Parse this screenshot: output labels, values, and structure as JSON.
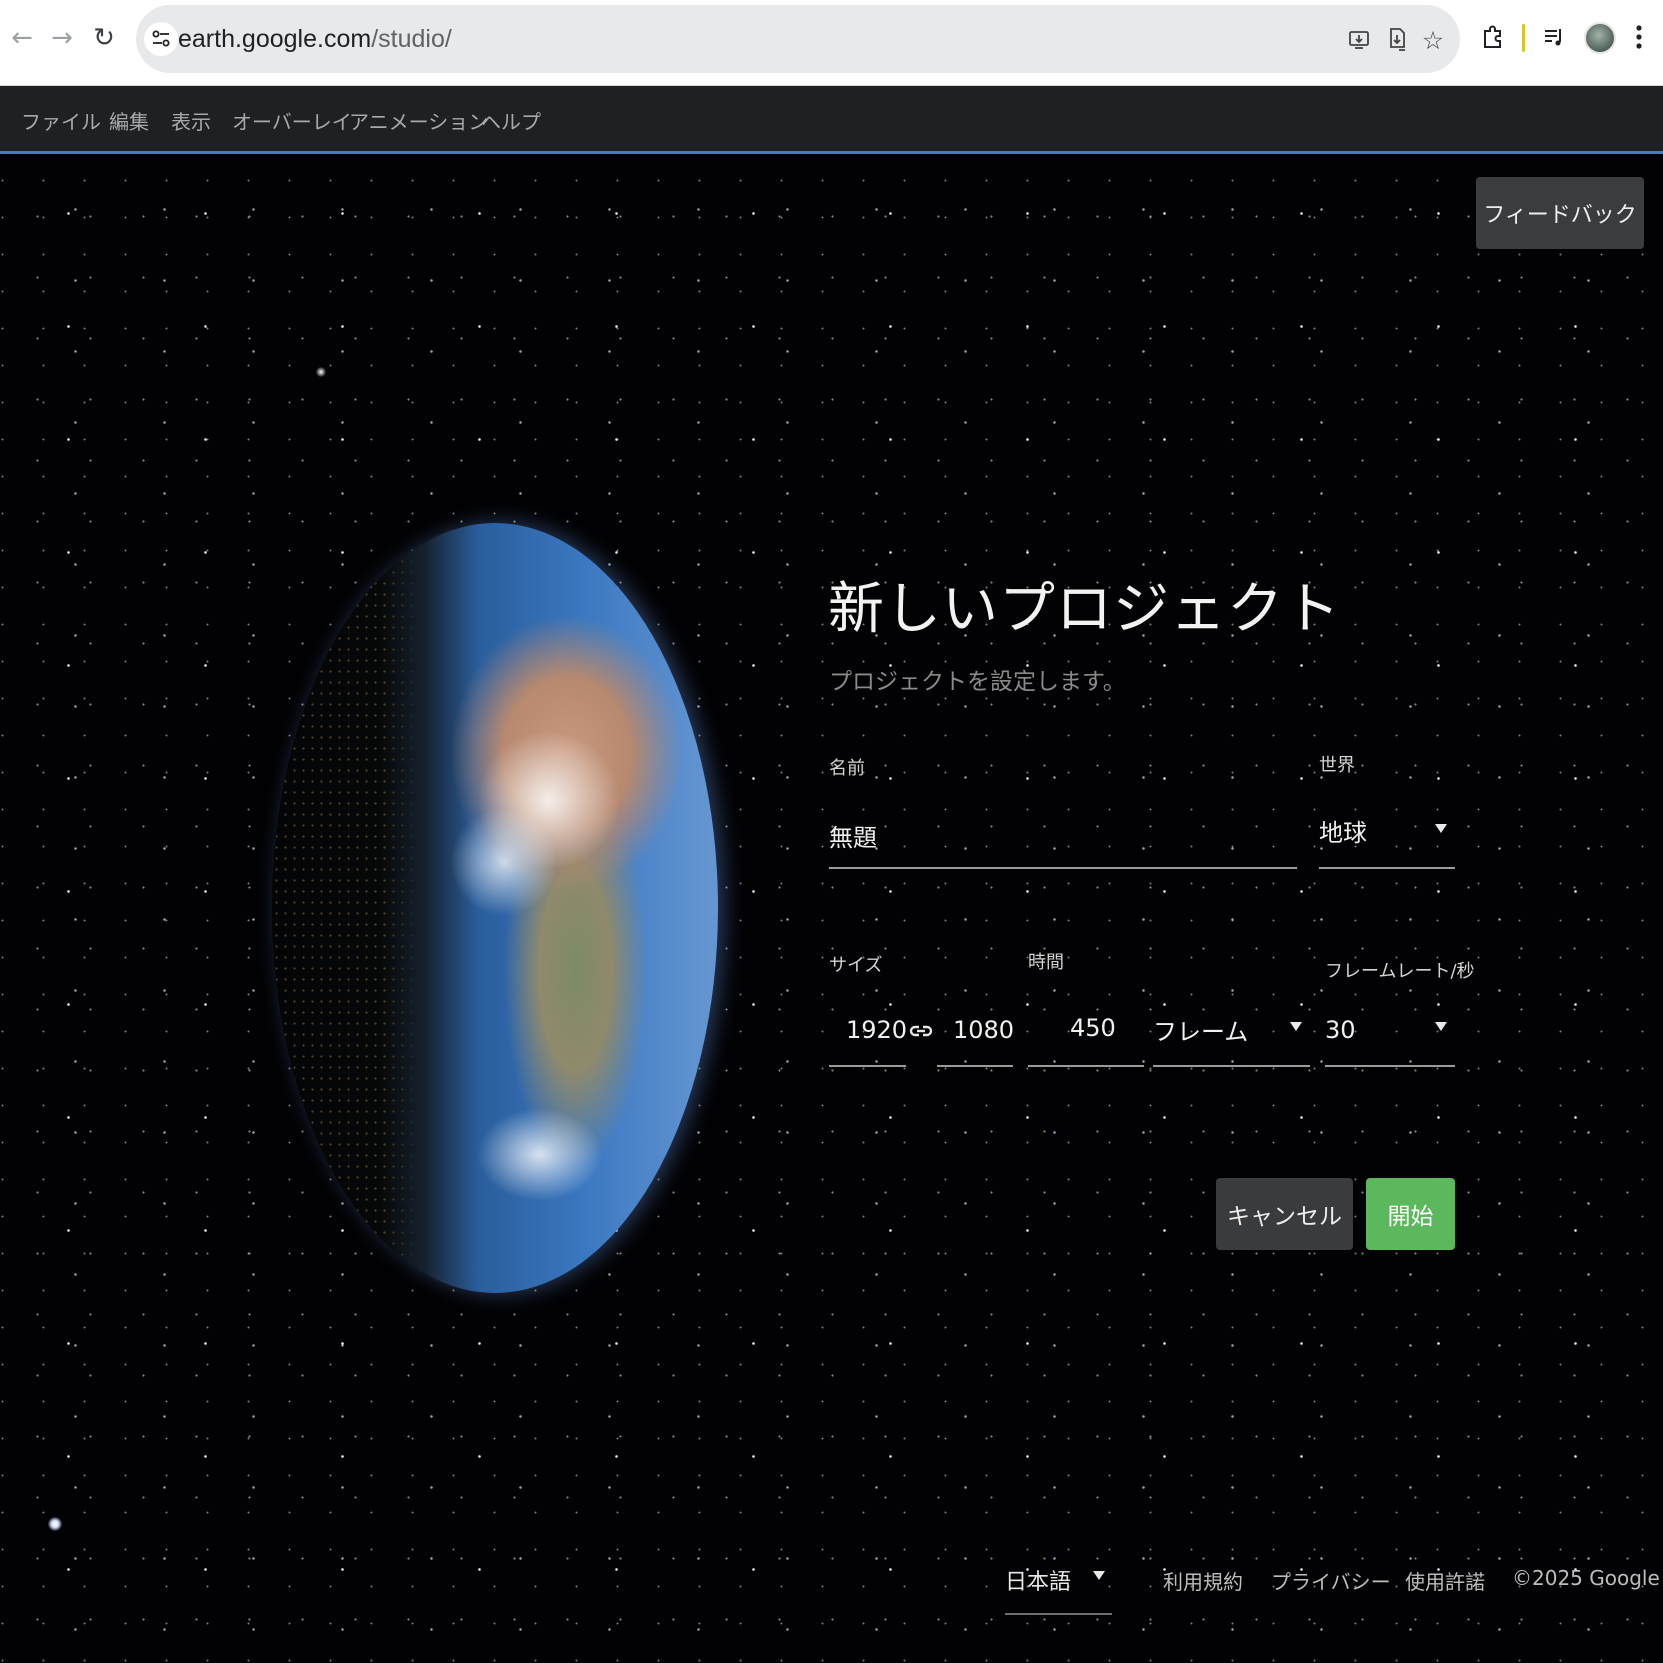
{
  "browser": {
    "url_host": "earth.google.com",
    "url_path": "/studio/",
    "icons": {
      "back": "arrow-left-icon",
      "forward": "arrow-right-icon",
      "reload": "reload-icon",
      "site_info": "tune-icon",
      "install": "install-app-icon",
      "download": "download-icon",
      "bookmark": "star-icon",
      "extensions": "puzzle-icon",
      "reading_list": "playlist-icon",
      "menu": "kebab-menu-icon"
    }
  },
  "menubar": {
    "items": [
      "ファイル",
      "編集",
      "表示",
      "オーバーレイ",
      "アニメーション",
      "ヘルプ"
    ]
  },
  "feedback": {
    "label": "フィードバック"
  },
  "dialog": {
    "title": "新しいプロジェクト",
    "subtitle": "プロジェクトを設定します。",
    "name": {
      "label": "名前",
      "value": "無題"
    },
    "world": {
      "label": "世界",
      "value": "地球"
    },
    "size": {
      "label": "サイズ",
      "width": "1920",
      "height": "1080"
    },
    "duration": {
      "label": "時間",
      "value": "450",
      "unit": "フレーム"
    },
    "framerate": {
      "label": "フレームレート/秒",
      "value": "30"
    },
    "cancel_label": "キャンセル",
    "start_label": "開始"
  },
  "footer": {
    "language": "日本語",
    "terms": "利用規約",
    "privacy": "プライバシー",
    "license": "使用許諾",
    "copyright": "©2025 Google"
  },
  "colors": {
    "menubar_bg": "#1f2023",
    "accent_line": "#4a78b8",
    "start_button": "#5cb85c",
    "cancel_button": "#3a3b3d"
  }
}
